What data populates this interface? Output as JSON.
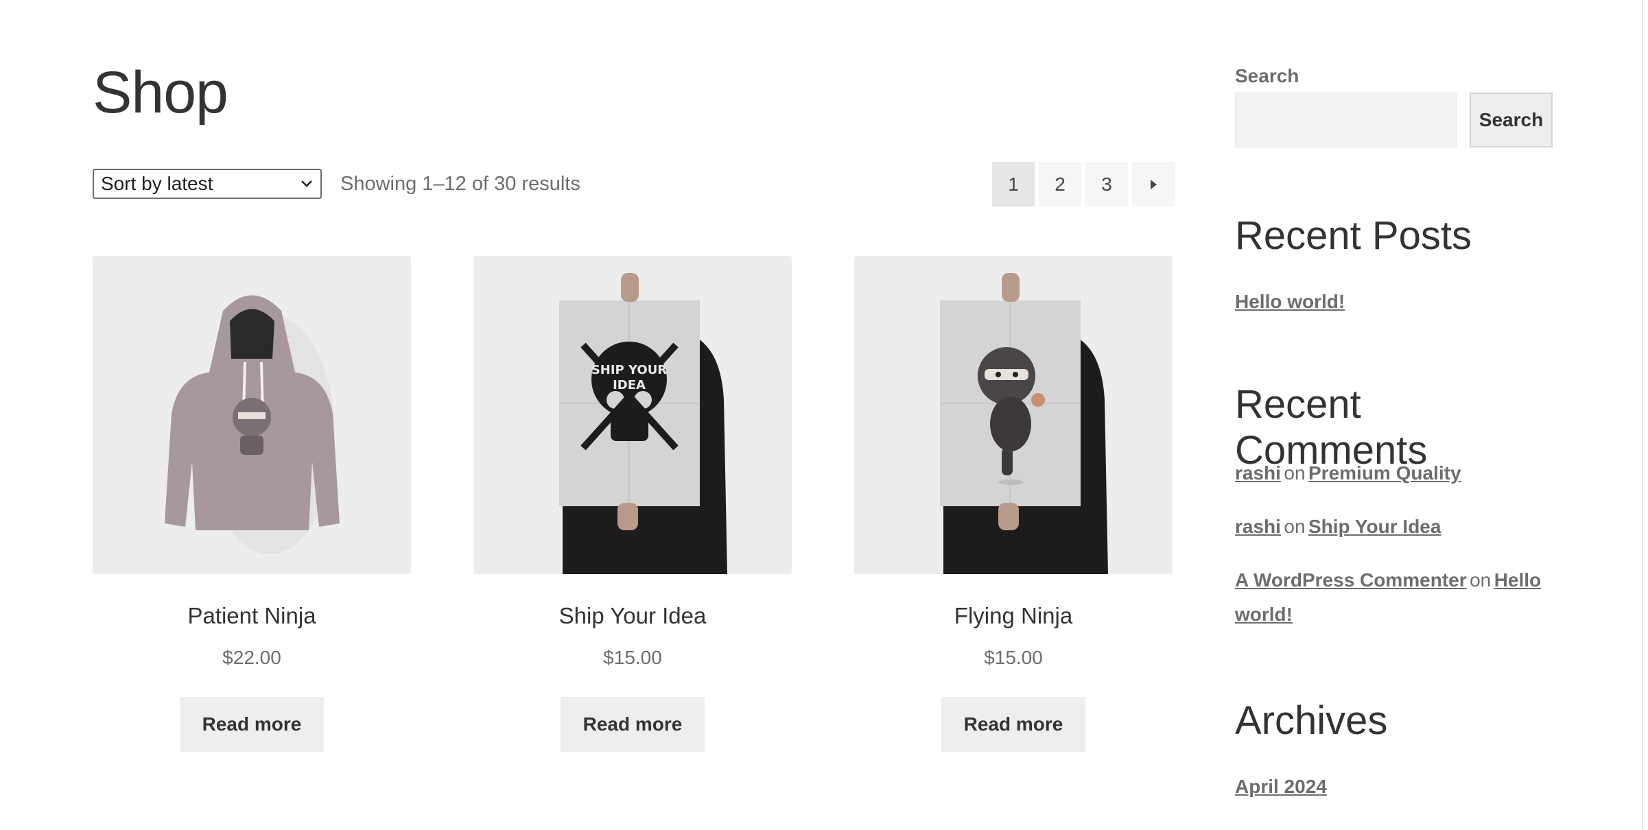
{
  "page": {
    "title": "Shop"
  },
  "toolbar": {
    "sort_selected": "Sort by latest",
    "result_count": "Showing 1–12 of 30 results"
  },
  "pagination": {
    "pages": [
      "1",
      "2",
      "3"
    ],
    "current": "1",
    "next_icon": "triangle-right-icon"
  },
  "products": [
    {
      "name": "Patient Ninja",
      "price": "$22.00",
      "button": "Read more",
      "image_icon": "hoodie-image"
    },
    {
      "name": "Ship Your Idea",
      "price": "$15.00",
      "button": "Read more",
      "image_icon": "poster-image",
      "poster_text": [
        "SHIP YOUR",
        "IDEA"
      ]
    },
    {
      "name": "Flying Ninja",
      "price": "$15.00",
      "button": "Read more",
      "image_icon": "poster-image"
    }
  ],
  "sidebar": {
    "search": {
      "label": "Search",
      "placeholder": "",
      "button": "Search"
    },
    "recent_posts": {
      "title": "Recent Posts",
      "items": [
        "Hello world!"
      ]
    },
    "recent_comments": {
      "title": "Recent Comments",
      "connector": "on",
      "items": [
        {
          "author": "rashi",
          "post": "Premium Quality"
        },
        {
          "author": "rashi",
          "post": "Ship Your Idea"
        },
        {
          "author": "A WordPress Commenter",
          "post_line1": "Hello",
          "post_line2": "world!"
        }
      ]
    },
    "archives": {
      "title": "Archives",
      "items": [
        "April 2024"
      ]
    }
  },
  "colors": {
    "text": "#43454b",
    "muted": "#6d6d6d",
    "button_bg": "#eeeeee",
    "thumb_bg": "#ededed"
  }
}
